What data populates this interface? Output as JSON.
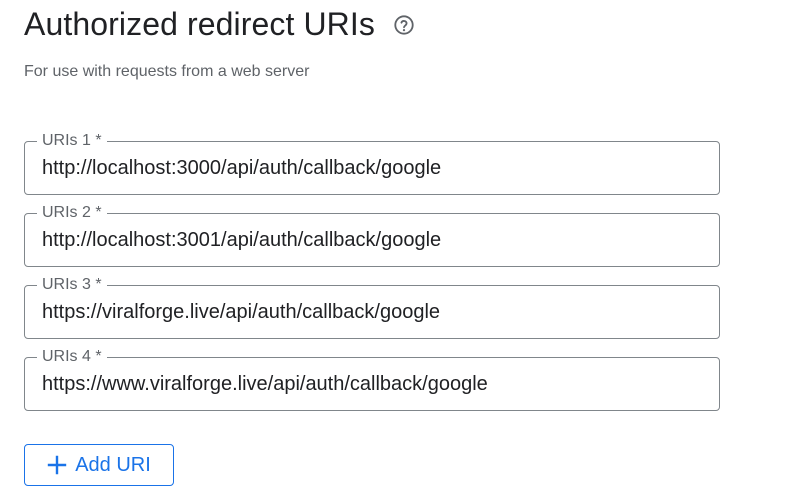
{
  "section": {
    "title": "Authorized redirect URIs",
    "subtitle": "For use with requests from a web server",
    "help_icon": "help-circle-outline-icon"
  },
  "uris": [
    {
      "label": "URIs 1 *",
      "value": "http://localhost:3000/api/auth/callback/google"
    },
    {
      "label": "URIs 2 *",
      "value": "http://localhost:3001/api/auth/callback/google"
    },
    {
      "label": "URIs 3 *",
      "value": "https://viralforge.live/api/auth/callback/google"
    },
    {
      "label": "URIs 4 *",
      "value": "https://www.viralforge.live/api/auth/callback/google"
    }
  ],
  "add_button": {
    "label": "Add URI",
    "icon": "plus-icon"
  },
  "colors": {
    "accent": "#1a73e8",
    "text_primary": "#202124",
    "text_secondary": "#5f6368",
    "field_border": "#80868b"
  }
}
